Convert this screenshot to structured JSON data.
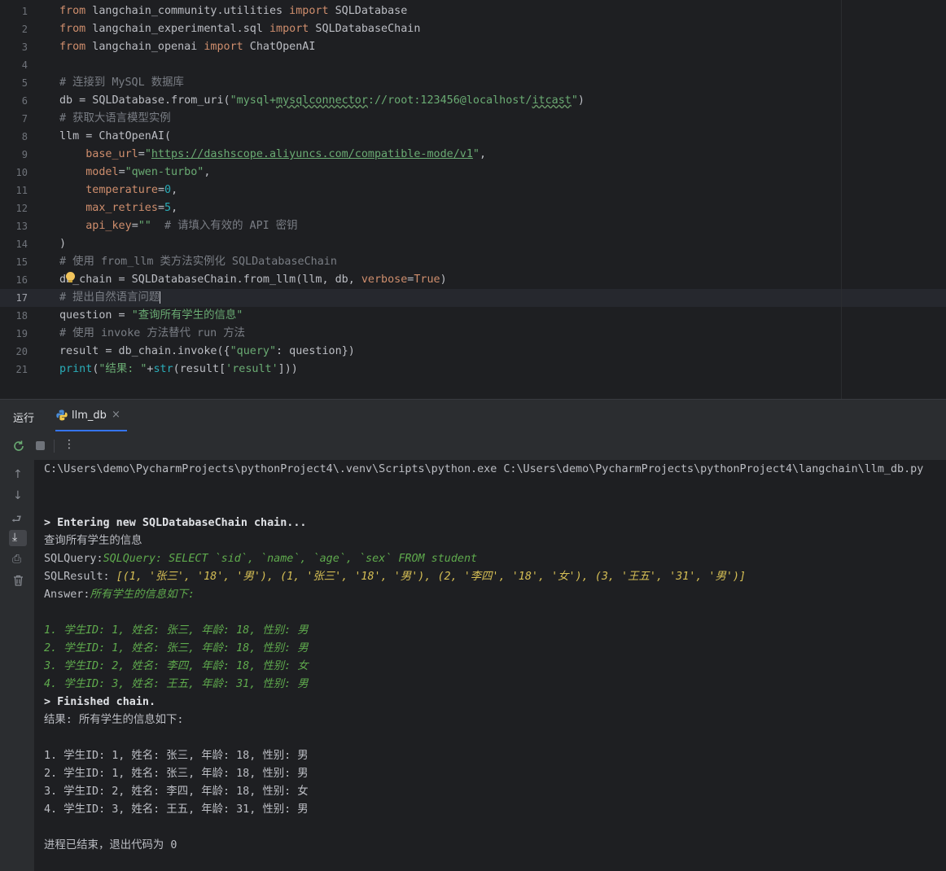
{
  "editor": {
    "line_numbers": [
      "1",
      "2",
      "3",
      "4",
      "5",
      "6",
      "7",
      "8",
      "9",
      "10",
      "11",
      "12",
      "13",
      "14",
      "15",
      "16",
      "17",
      "18",
      "19",
      "20",
      "21"
    ],
    "l1": {
      "k1": "from",
      "m": " langchain_community.utilities ",
      "k2": "import",
      "n": " SQLDatabase"
    },
    "l2": {
      "k1": "from",
      "m": " langchain_experimental.sql ",
      "k2": "import",
      "n": " SQLDatabaseChain"
    },
    "l3": {
      "k1": "from",
      "m": " langchain_openai ",
      "k2": "import",
      "n": " ChatOpenAI"
    },
    "l5": {
      "c": "# 连接到 MySQL 数据库"
    },
    "l6": {
      "a": "db = SQLDatabase.from_uri(",
      "s1": "\"mysql+",
      "s2": "mysqlconnector",
      "s3": "://root:123456@localhost/",
      "s4": "itcast",
      "s5": "\"",
      "e": ")"
    },
    "l7": {
      "c": "# 获取大语言模型实例"
    },
    "l8": {
      "a": "llm = ChatOpenAI("
    },
    "l9": {
      "i": "    ",
      "p": "base_url",
      "eq": "=",
      "q1": "\"",
      "u": "https://dashscope.aliyuncs.com/compatible-mode/v1",
      "q2": "\"",
      "e": ","
    },
    "l10": {
      "i": "    ",
      "p": "model",
      "eq": "=",
      "s": "\"qwen-turbo\"",
      "e": ","
    },
    "l11": {
      "i": "    ",
      "p": "temperature",
      "eq": "=",
      "n": "0",
      "e": ","
    },
    "l12": {
      "i": "    ",
      "p": "max_retries",
      "eq": "=",
      "n": "5",
      "e": ","
    },
    "l13": {
      "i": "    ",
      "p": "api_key",
      "eq": "=",
      "s": "\"\"",
      "c": "  # 请填入有效的 API 密钥"
    },
    "l14": {
      "a": ")"
    },
    "l15": {
      "c": "# 使用 from_llm 类方法实例化 SQLDatabaseChain"
    },
    "l16": {
      "a": "db_chain = SQLDatabaseChain.from_llm(llm, db, ",
      "p": "verbose",
      "eq": "=",
      "k": "True",
      "e": ")"
    },
    "l17": {
      "c": "# 提出自然语言问题"
    },
    "l18": {
      "a": "question = ",
      "s": "\"查询所有学生的信息\""
    },
    "l19": {
      "c": "# 使用 invoke 方法替代 run 方法"
    },
    "l20": {
      "a": "result = db_chain.invoke({",
      "s": "\"query\"",
      "e": ": question})"
    },
    "l21": {
      "f": "print",
      "a": "(",
      "s": "\"结果: \"",
      "b": "+",
      "f2": "str",
      "c": "(result[",
      "s2": "'result'",
      "e": "]))"
    }
  },
  "run_panel": {
    "title": "运行",
    "tab_name": "llm_db",
    "close": "×"
  },
  "console": {
    "cmd": "C:\\Users\\demo\\PycharmProjects\\pythonProject4\\.venv\\Scripts\\python.exe C:\\Users\\demo\\PycharmProjects\\pythonProject4\\langchain\\llm_db.py",
    "entering": "> Entering new SQLDatabaseChain chain...",
    "question": "查询所有学生的信息",
    "sqlquery_label": "SQLQuery:",
    "sqlquery": "SQLQuery: SELECT `sid`, `name`, `age`, `sex` FROM student",
    "sqlresult_label": "SQLResult: ",
    "sqlresult": "[(1, '张三', '18', '男'), (1, '张三', '18', '男'), (2, '李四', '18', '女'), (3, '王五', '31', '男')]",
    "answer_label": "Answer:",
    "answer": "所有学生的信息如下:",
    "green_items": [
      "1. 学生ID: 1, 姓名: 张三, 年龄: 18, 性别: 男",
      "2. 学生ID: 1, 姓名: 张三, 年龄: 18, 性别: 男",
      "3. 学生ID: 2, 姓名: 李四, 年龄: 18, 性别: 女",
      "4. 学生ID: 3, 姓名: 王五, 年龄: 31, 性别: 男"
    ],
    "finished": "> Finished chain.",
    "result_line": "结果: 所有学生的信息如下:",
    "plain_items": [
      "1. 学生ID: 1, 姓名: 张三, 年龄: 18, 性别: 男",
      "2. 学生ID: 1, 姓名: 张三, 年龄: 18, 性别: 男",
      "3. 学生ID: 2, 姓名: 李四, 年龄: 18, 性别: 女",
      "4. 学生ID: 3, 姓名: 王五, 年龄: 31, 性别: 男"
    ],
    "exit": "进程已结束，退出代码为 0"
  },
  "colors": {
    "keyword": "#cf8e6d",
    "string": "#6aab73",
    "comment": "#7a7e85",
    "number": "#2aacb8",
    "param": "#c77dbb",
    "accent": "#3574f0"
  }
}
